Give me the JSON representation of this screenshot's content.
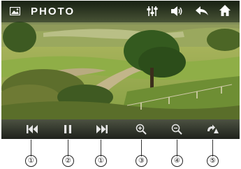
{
  "header": {
    "title": "PHOTO",
    "icons": [
      "image-icon",
      "equalizer-icon",
      "volume-icon",
      "back-arrow-icon",
      "home-icon"
    ]
  },
  "controls": {
    "buttons": [
      "previous",
      "pause",
      "next",
      "zoom-in",
      "zoom-out",
      "rotate"
    ],
    "callouts": [
      "①",
      "②",
      "①",
      "③",
      "④",
      "⑤"
    ]
  },
  "colors": {
    "bar_icon": "#ffffff",
    "control_icon": "#e6e6e6"
  }
}
